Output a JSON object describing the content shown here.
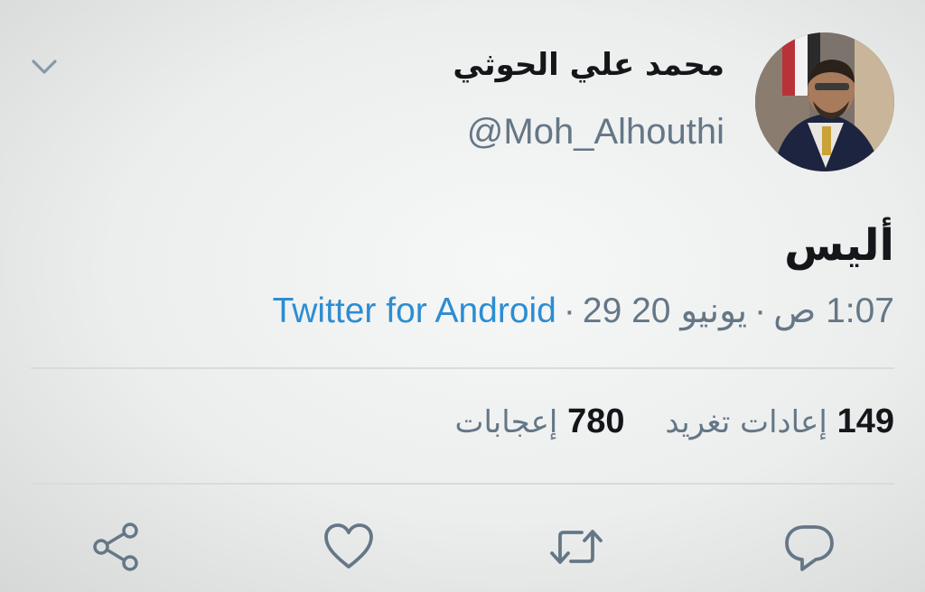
{
  "author": {
    "display_name": "محمد علي الحوثي",
    "handle": "@Moh_Alhouthi"
  },
  "tweet": {
    "text": "أليس",
    "time": "1:07 ص",
    "date": "29 يونيو 20",
    "source": "Twitter for Android"
  },
  "stats": {
    "retweets_count": "149",
    "retweets_label": "إعادات تغريد",
    "likes_count": "780",
    "likes_label": "إعجابات"
  },
  "icons": {
    "menu": "chevron-down-icon",
    "reply": "reply-icon",
    "retweet": "retweet-icon",
    "like": "heart-icon",
    "share": "share-icon"
  },
  "colors": {
    "link": "#2c8dd1",
    "muted": "#657786",
    "text": "#14171a"
  }
}
